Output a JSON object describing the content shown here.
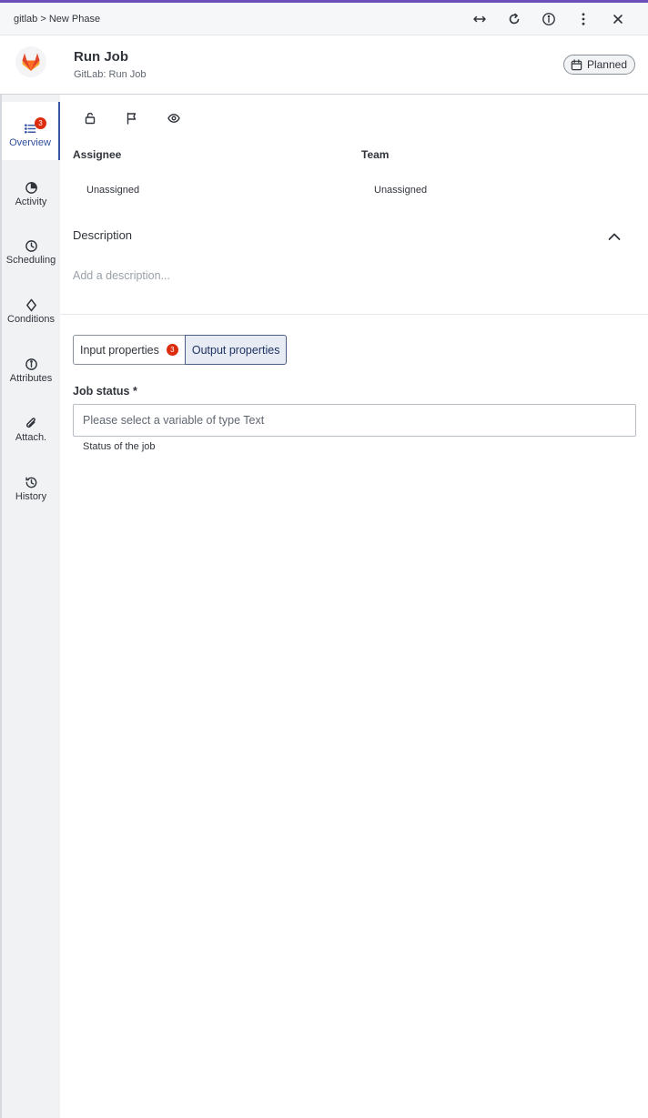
{
  "breadcrumb": "gitlab > New Phase",
  "window_actions": [
    {
      "name": "expand-icon",
      "label": "expand"
    },
    {
      "name": "refresh-icon",
      "label": "refresh"
    },
    {
      "name": "info-icon",
      "label": "info"
    },
    {
      "name": "more-vertical-icon",
      "label": "more"
    },
    {
      "name": "close-icon",
      "label": "close"
    }
  ],
  "header": {
    "title": "Run Job",
    "subtitle": "GitLab: Run Job",
    "status": "Planned",
    "status_icon": "calendar-icon",
    "logo": "gitlab-logo"
  },
  "sidebar": {
    "items": [
      {
        "label": "Overview",
        "icon": "list-icon",
        "badge": "3",
        "active": true
      },
      {
        "label": "Activity",
        "icon": "pie-icon"
      },
      {
        "label": "Scheduling",
        "icon": "clock-icon"
      },
      {
        "label": "Conditions",
        "icon": "diamond-icon"
      },
      {
        "label": "Attributes",
        "icon": "info-icon"
      },
      {
        "label": "Attach.",
        "icon": "paperclip-icon"
      },
      {
        "label": "History",
        "icon": "history-icon"
      }
    ]
  },
  "toolbar": {
    "icons": [
      "unlock-icon",
      "flag-icon",
      "eye-icon"
    ]
  },
  "fields": {
    "assignee_label": "Assignee",
    "assignee_value": "Unassigned",
    "team_label": "Team",
    "team_value": "Unassigned"
  },
  "description": {
    "heading": "Description",
    "placeholder": "Add a description..."
  },
  "tabs": [
    {
      "label": "Input properties",
      "badge": "3"
    },
    {
      "label": "Output properties",
      "selected": true
    }
  ],
  "job_status": {
    "label": "Job status *",
    "placeholder": "Please select a variable of type Text",
    "help": "Status of the job"
  },
  "colors": {
    "accent": "#6b4fbb",
    "badge": "#dd2b0e",
    "active_nav": "#3a58a6"
  }
}
